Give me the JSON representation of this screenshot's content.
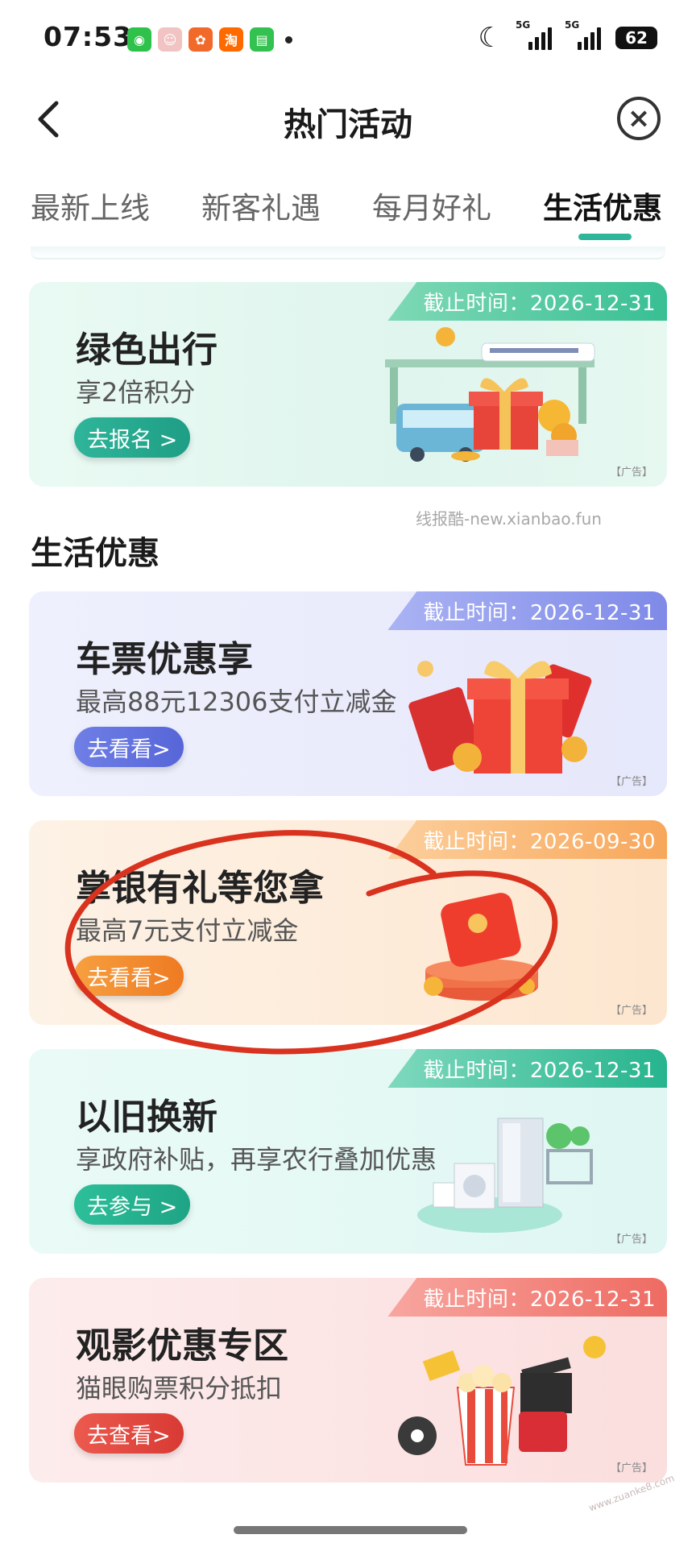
{
  "status_bar": {
    "time": "07:53",
    "network_1": "5G",
    "network_2": "5G",
    "battery": "62"
  },
  "nav": {
    "title": "热门活动"
  },
  "tabs": [
    {
      "label": "最新上线",
      "active": false
    },
    {
      "label": "新客礼遇",
      "active": false
    },
    {
      "label": "每月好礼",
      "active": false
    },
    {
      "label": "生活优惠",
      "active": true
    }
  ],
  "promo_card": {
    "deadline": "截止时间：2026-12-31",
    "title": "绿色出行",
    "subtitle": "享2倍积分",
    "button": "去报名 >",
    "ad_tag": "【广告】"
  },
  "watermark": "线报酷-new.xianbao.fun",
  "section": {
    "title": "生活优惠"
  },
  "cards": [
    {
      "deadline": "截止时间：2026-12-31",
      "title": "车票优惠享",
      "subtitle": "最高88元12306支付立减金",
      "button": "去看看>",
      "ad_tag": "【广告】"
    },
    {
      "deadline": "截止时间：2026-09-30",
      "title": "掌银有礼等您拿",
      "subtitle": "最高7元支付立减金",
      "button": "去看看>",
      "ad_tag": "【广告】"
    },
    {
      "deadline": "截止时间：2026-12-31",
      "title": "以旧换新",
      "subtitle": "享政府补贴，再享农行叠加优惠",
      "button": "去参与 >",
      "ad_tag": "【广告】"
    },
    {
      "deadline": "截止时间：2026-12-31",
      "title": "观影优惠专区",
      "subtitle": "猫眼购票积分抵扣",
      "button": "去查看>",
      "ad_tag": "【广告】"
    }
  ],
  "corner_watermark": "www.zuanke8.com",
  "colors": {
    "green": "#2fb59a",
    "blue": "#6f7fe6",
    "orange": "#f08a2e",
    "teal": "#22b894",
    "red": "#e5473f",
    "annotation": "#d9321f"
  }
}
